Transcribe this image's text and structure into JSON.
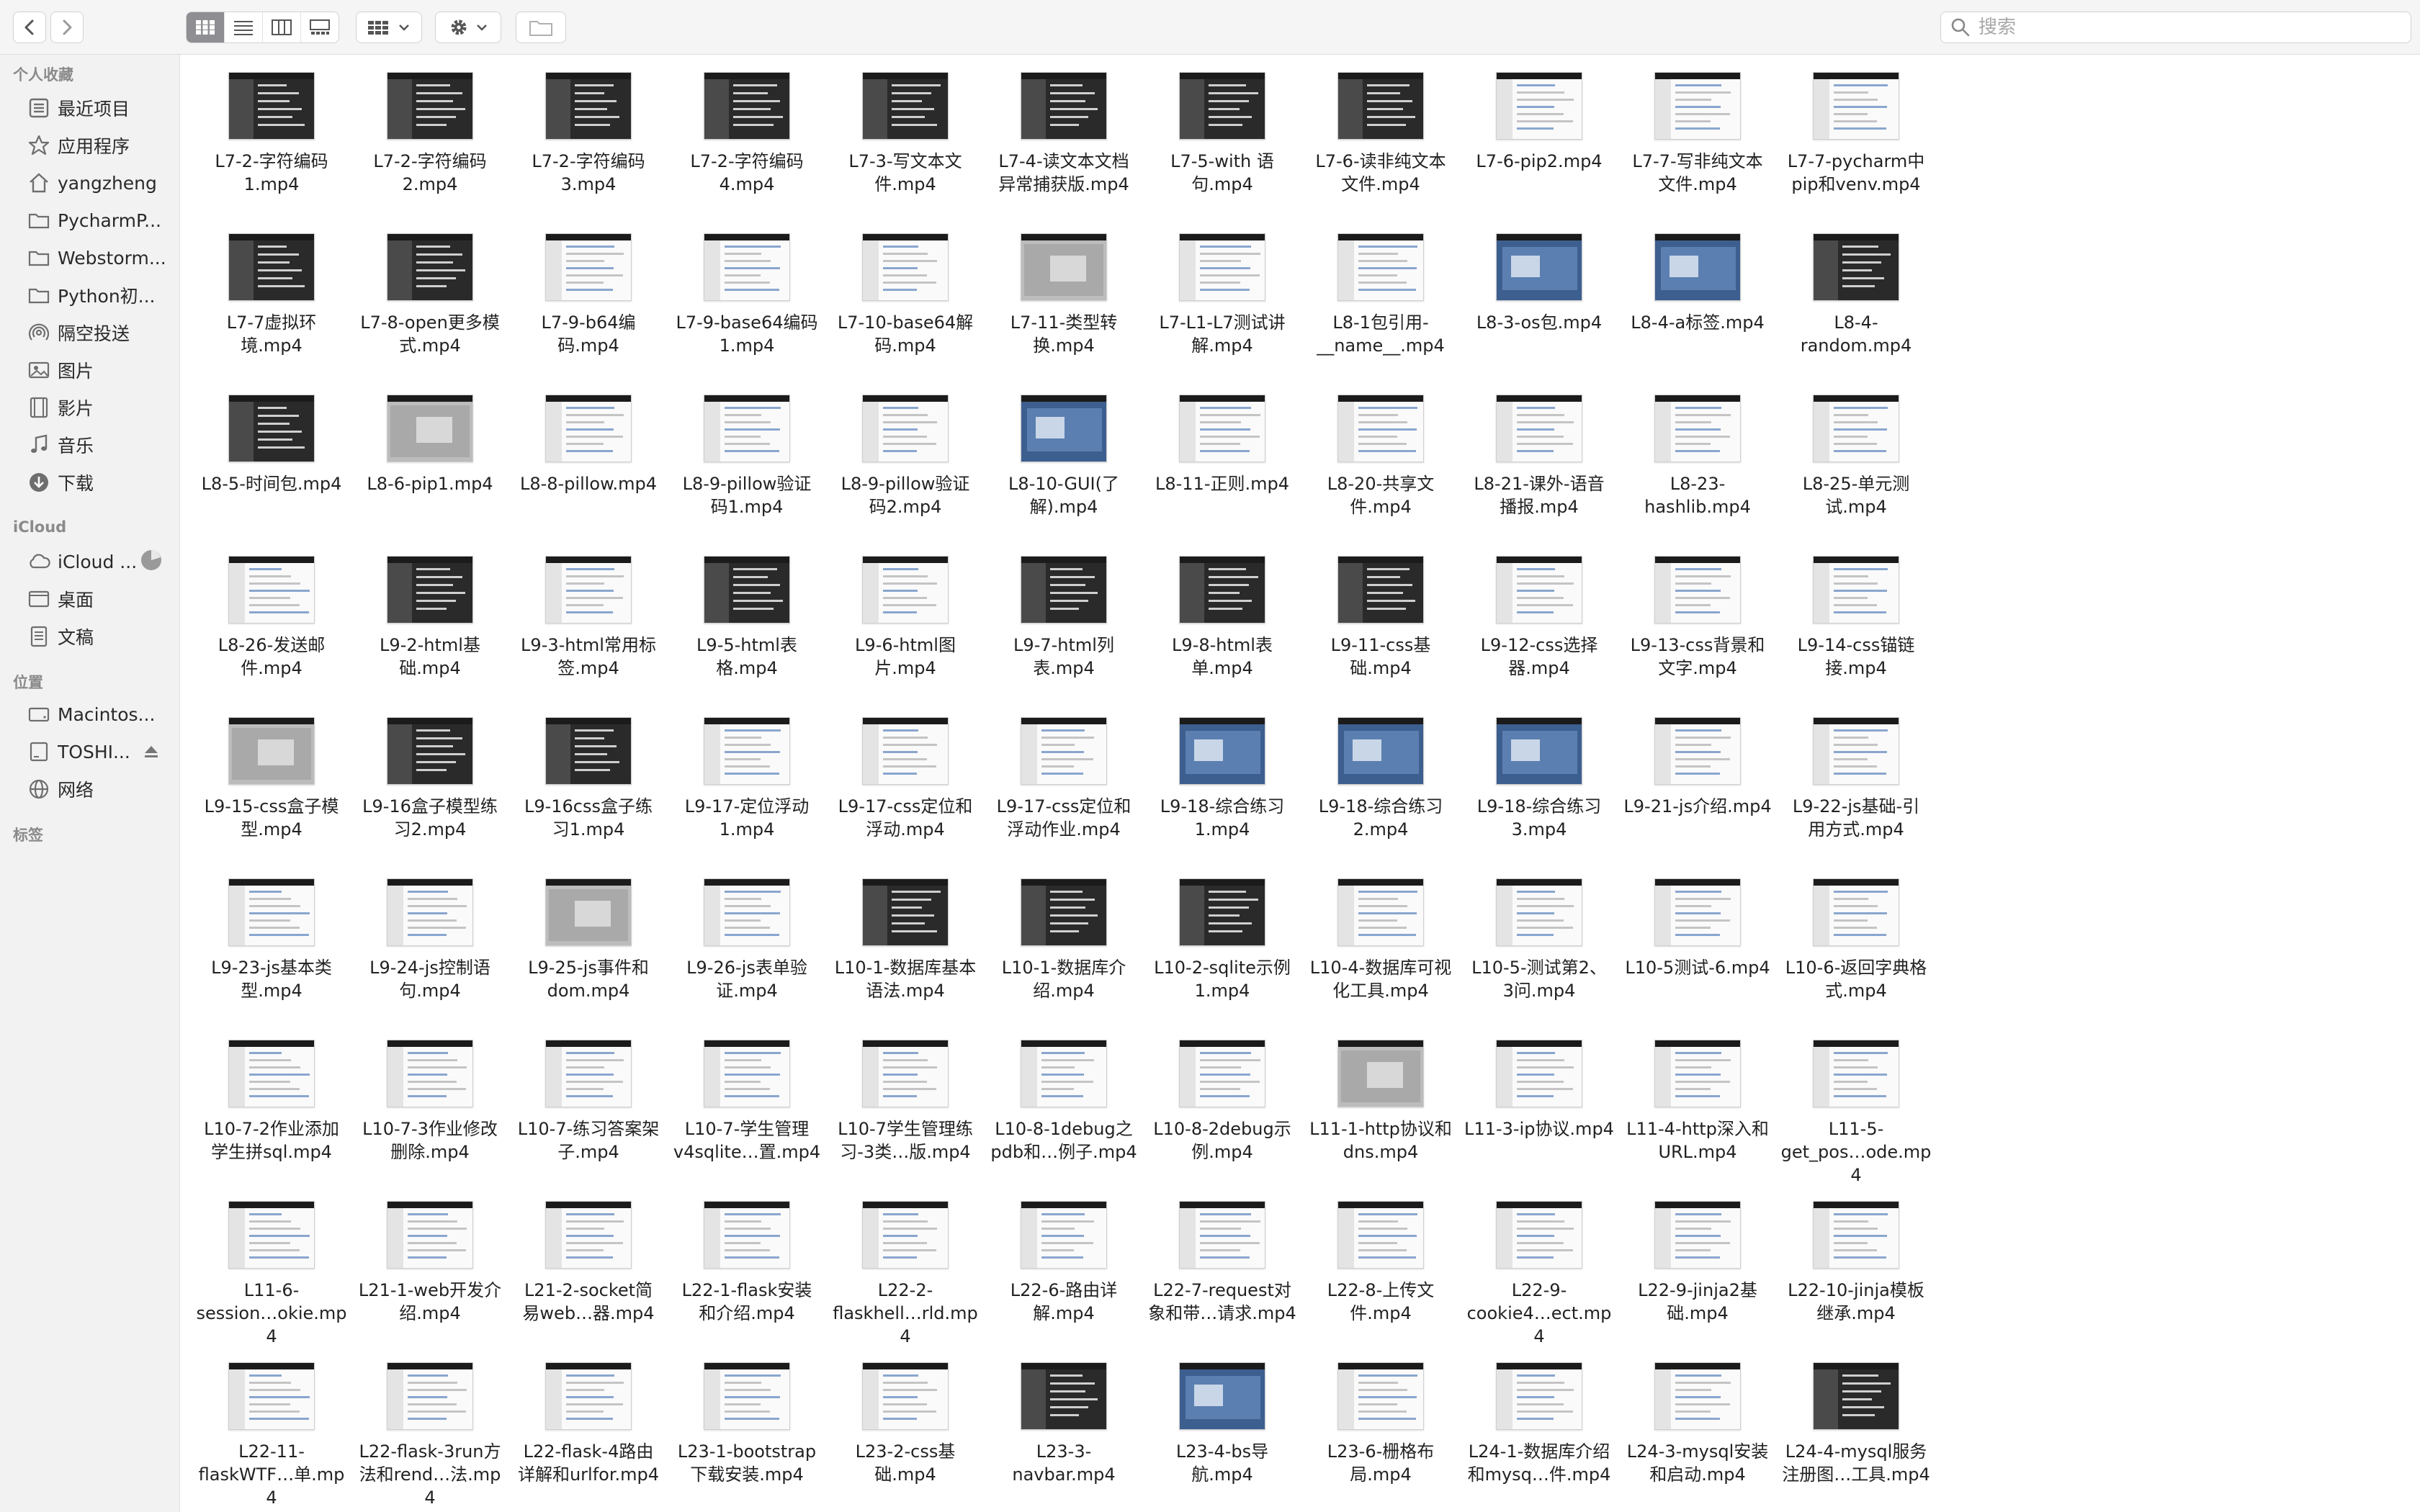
{
  "toolbar": {
    "search_placeholder": "搜索",
    "view_modes": [
      "icon-view",
      "list-view",
      "column-view",
      "gallery-view"
    ],
    "active_view": 0
  },
  "sidebar": {
    "favorites_title": "个人收藏",
    "favorites": [
      {
        "label": "最近项目",
        "icon": "clock-icon"
      },
      {
        "label": "应用程序",
        "icon": "apps-icon"
      },
      {
        "label": "yangzheng",
        "icon": "home-icon"
      },
      {
        "label": "PycharmP...",
        "icon": "folder-icon"
      },
      {
        "label": "Webstorm...",
        "icon": "folder-icon"
      },
      {
        "label": "Python初...",
        "icon": "folder-icon"
      },
      {
        "label": "隔空投送",
        "icon": "airdrop-icon"
      },
      {
        "label": "图片",
        "icon": "photo-icon"
      },
      {
        "label": "影片",
        "icon": "film-icon"
      },
      {
        "label": "音乐",
        "icon": "music-icon"
      },
      {
        "label": "下载",
        "icon": "download-icon"
      }
    ],
    "icloud_title": "iCloud",
    "icloud": [
      {
        "label": "iCloud ...",
        "icon": "cloud-icon"
      },
      {
        "label": "桌面",
        "icon": "desktop-icon"
      },
      {
        "label": "文稿",
        "icon": "document-icon"
      }
    ],
    "locations_title": "位置",
    "locations": [
      {
        "label": "Macintos...",
        "icon": "disk-icon"
      },
      {
        "label": "TOSHI...",
        "icon": "external-disk-icon"
      },
      {
        "label": "网络",
        "icon": "network-icon"
      }
    ],
    "tags_title": "标签"
  },
  "files": [
    [
      "L7-2-字符编码\n1.mp4",
      "L7-2-字符编码\n2.mp4",
      "L7-2-字符编码\n3.mp4",
      "L7-2-字符编码\n4.mp4",
      "L7-3-写文本文\n件.mp4",
      "L7-4-读文本文档\n异常捕获版.mp4",
      "L7-5-with 语\n句.mp4",
      "L7-6-读非纯文本\n文件.mp4",
      "L7-6-pip2.mp4",
      "L7-7-写非纯文本\n文件.mp4",
      "L7-7-pycharm中\npip和venv.mp4"
    ],
    [
      "L7-7虚拟环\n境.mp4",
      "L7-8-open更多模\n式.mp4",
      "L7-9-b64编\n码.mp4",
      "L7-9-base64编码\n1.mp4",
      "L7-10-base64解\n码.mp4",
      "L7-11-类型转\n换.mp4",
      "L7-L1-L7测试讲\n解.mp4",
      "L8-1包引用-\n__name__.mp4",
      "L8-3-os包.mp4",
      "L8-4-a标签.mp4",
      "L8-4-\nrandom.mp4"
    ],
    [
      "L8-5-时间包.mp4",
      "L8-6-pip1.mp4",
      "L8-8-pillow.mp4",
      "L8-9-pillow验证\n码1.mp4",
      "L8-9-pillow验证\n码2.mp4",
      "L8-10-GUI(了\n解).mp4",
      "L8-11-正则.mp4",
      "L8-20-共享文\n件.mp4",
      "L8-21-课外-语音\n播报.mp4",
      "L8-23-\nhashlib.mp4",
      "L8-25-单元测\n试.mp4"
    ],
    [
      "L8-26-发送邮\n件.mp4",
      "L9-2-html基\n础.mp4",
      "L9-3-html常用标\n签.mp4",
      "L9-5-html表\n格.mp4",
      "L9-6-html图\n片.mp4",
      "L9-7-html列\n表.mp4",
      "L9-8-html表\n单.mp4",
      "L9-11-css基\n础.mp4",
      "L9-12-css选择\n器.mp4",
      "L9-13-css背景和\n文字.mp4",
      "L9-14-css锚链\n接.mp4"
    ],
    [
      "L9-15-css盒子模\n型.mp4",
      "L9-16盒子模型练\n习2.mp4",
      "L9-16css盒子练\n习1.mp4",
      "L9-17-定位浮动\n1.mp4",
      "L9-17-css定位和\n浮动.mp4",
      "L9-17-css定位和\n浮动作业.mp4",
      "L9-18-综合练习\n1.mp4",
      "L9-18-综合练习\n2.mp4",
      "L9-18-综合练习\n3.mp4",
      "L9-21-js介绍.mp4",
      "L9-22-js基础-引\n用方式.mp4"
    ],
    [
      "L9-23-js基本类\n型.mp4",
      "L9-24-js控制语\n句.mp4",
      "L9-25-js事件和\ndom.mp4",
      "L9-26-js表单验\n证.mp4",
      "L10-1-数据库基本\n语法.mp4",
      "L10-1-数据库介\n绍.mp4",
      "L10-2-sqlite示例\n1.mp4",
      "L10-4-数据库可视\n化工具.mp4",
      "L10-5-测试第2、\n3问.mp4",
      "L10-5测试-6.mp4",
      "L10-6-返回字典格\n式.mp4"
    ],
    [
      "L10-7-2作业添加\n学生拼sql.mp4",
      "L10-7-3作业修改\n删除.mp4",
      "L10-7-练习答案架\n子.mp4",
      "L10-7-学生管理\nv4sqlite…置.mp4",
      "L10-7学生管理练\n习-3类…版.mp4",
      "L10-8-1debug之\npdb和…例子.mp4",
      "L10-8-2debug示\n例.mp4",
      "L11-1-http协议和\ndns.mp4",
      "L11-3-ip协议.mp4",
      "L11-4-http深入和\nURL.mp4",
      "L11-5-\nget_pos…ode.mp4"
    ],
    [
      "L11-6-\nsession…okie.mp4",
      "L21-1-web开发介\n绍.mp4",
      "L21-2-socket简\n易web…器.mp4",
      "L22-1-flask安装\n和介绍.mp4",
      "L22-2-\nflaskhell…rld.mp4",
      "L22-6-路由详\n解.mp4",
      "L22-7-request对\n象和带…请求.mp4",
      "L22-8-上传文\n件.mp4",
      "L22-9-\ncookie4…ect.mp4",
      "L22-9-jinja2基\n础.mp4",
      "L22-10-jinja模板\n继承.mp4"
    ],
    [
      "L22-11-\nflaskWTF…单.mp4",
      "L22-flask-3run方\n法和rend…法.mp4",
      "L22-flask-4路由\n详解和urlfor.mp4",
      "L23-1-bootstrap\n下载安装.mp4",
      "L23-2-css基\n础.mp4",
      "L23-3-\nnavbar.mp4",
      "L23-4-bs导\n航.mp4",
      "L23-6-栅格布\n局.mp4",
      "L24-1-数据库介绍\n和mysq…件.mp4",
      "L24-3-mysql安装\n和启动.mp4",
      "L24-4-mysql服务\n注册图…工具.mp4"
    ]
  ],
  "thumb_styles": [
    [
      "dark",
      "dark",
      "dark",
      "dark",
      "dark",
      "dark",
      "dark",
      "dark",
      "light",
      "light",
      "light"
    ],
    [
      "dark",
      "dark",
      "light",
      "light",
      "light",
      "gray",
      "light",
      "light",
      "blue",
      "blue",
      "dark"
    ],
    [
      "dark",
      "gray",
      "light",
      "light",
      "light",
      "blue",
      "light",
      "light",
      "light",
      "light",
      "light"
    ],
    [
      "light",
      "dark",
      "light",
      "dark",
      "light",
      "dark",
      "dark",
      "dark",
      "light",
      "light",
      "light"
    ],
    [
      "gray",
      "dark",
      "dark",
      "light",
      "light",
      "light",
      "blue",
      "blue",
      "blue",
      "light",
      "light"
    ],
    [
      "light",
      "light",
      "gray",
      "light",
      "dark",
      "dark",
      "dark",
      "light",
      "light",
      "light",
      "light"
    ],
    [
      "light",
      "light",
      "light",
      "light",
      "light",
      "light",
      "light",
      "gray",
      "light",
      "light",
      "light"
    ],
    [
      "light",
      "light",
      "light",
      "light",
      "light",
      "light",
      "light",
      "light",
      "light",
      "light",
      "light"
    ],
    [
      "light",
      "light",
      "light",
      "light",
      "light",
      "dark",
      "blue",
      "light",
      "light",
      "light",
      "dark"
    ]
  ]
}
